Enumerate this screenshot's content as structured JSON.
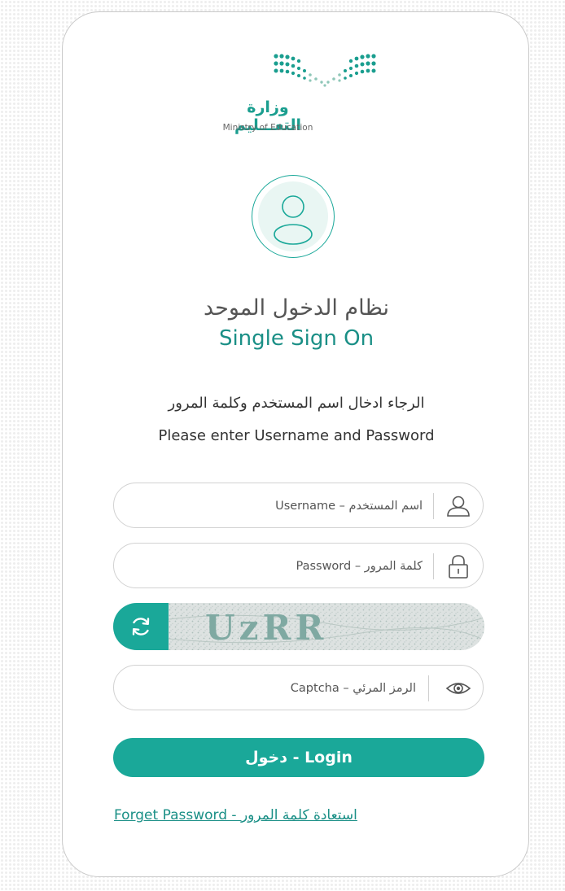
{
  "logo": {
    "arabic_name": "وزارة التعـــليم",
    "english_name": "Ministry of Education"
  },
  "avatar_icon": "user-avatar-icon",
  "title": {
    "arabic": "نظام الدخول الموحد",
    "english": "Single Sign On"
  },
  "instructions": {
    "arabic": "الرجاء ادخال اسم المستخدم وكلمة المرور",
    "english": "Please enter Username and Password"
  },
  "username": {
    "icon": "user-icon",
    "value": "",
    "placeholder": "اسم المستخدم – Username"
  },
  "password": {
    "icon": "lock-icon",
    "value": "",
    "placeholder": "كلمة المرور – Password"
  },
  "captcha": {
    "refresh_icon": "refresh-icon",
    "image_text": "UzRR"
  },
  "captcha_input": {
    "icon": "eye-icon",
    "value": "",
    "placeholder": "الرمز المرئي – Captcha"
  },
  "login_button": "دخول - Login",
  "forgot_password_link": "Forget Password - استعادة كلمة المرور",
  "colors": {
    "primary": "#1aa899",
    "title_teal": "#1a8f86",
    "border": "#d2d2d2"
  }
}
